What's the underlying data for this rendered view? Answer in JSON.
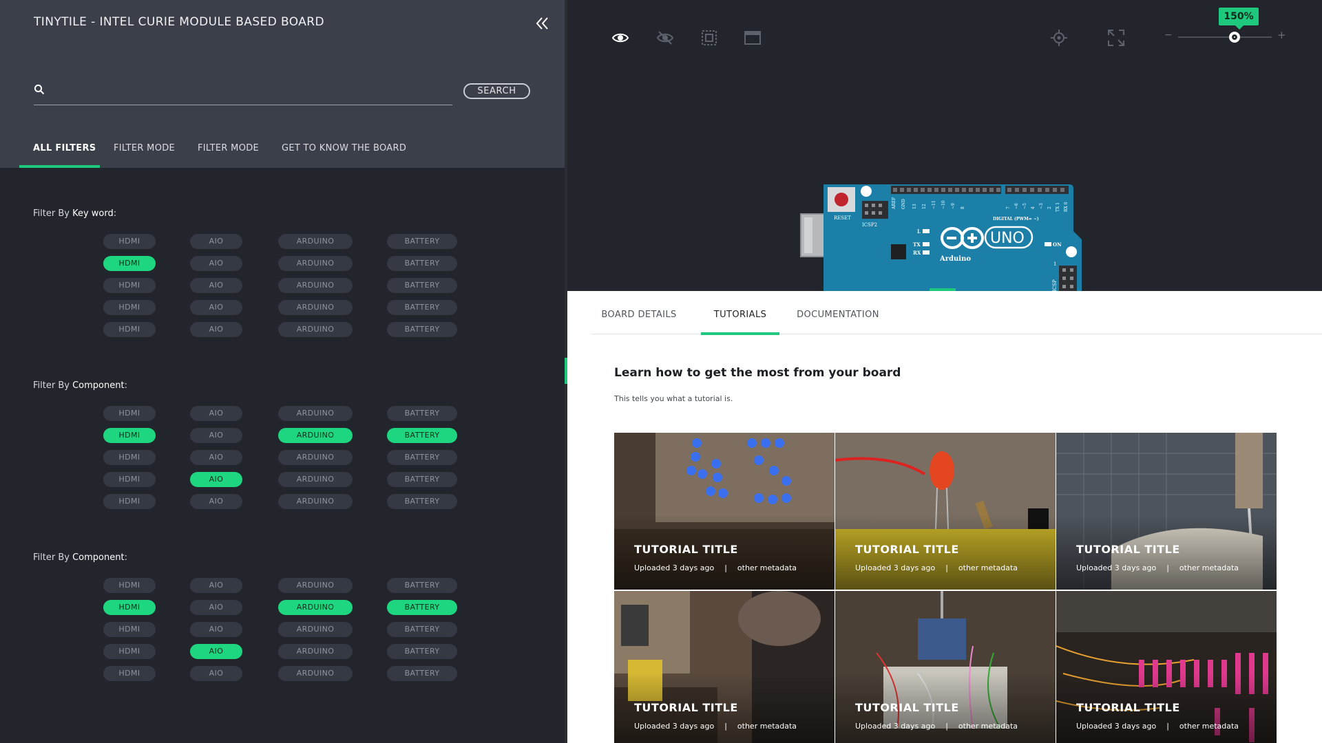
{
  "app": {
    "board_title": "TINYTILE - INTEL CURIE MODULE BASED BOARD"
  },
  "search": {
    "value": "",
    "placeholder": "",
    "button_label": "SEARCH"
  },
  "filter_tabs": [
    {
      "label": "ALL FILTERS",
      "active": true
    },
    {
      "label": "FILTER MODE",
      "active": false
    },
    {
      "label": "FILTER MODE",
      "active": false
    },
    {
      "label": "GET TO KNOW THE BOARD",
      "active": false
    }
  ],
  "filter_sections": [
    {
      "label_prefix": "Filter By ",
      "label_keyword": "Key word",
      "label_suffix": ":",
      "rows": [
        [
          {
            "label": "HDMI",
            "on": false
          },
          {
            "label": "AIO",
            "on": false
          },
          {
            "label": "ARDUINO",
            "on": false
          },
          {
            "label": "BATTERY",
            "on": false
          }
        ],
        [
          {
            "label": "HDMI",
            "on": true
          },
          {
            "label": "AIO",
            "on": false
          },
          {
            "label": "ARDUINO",
            "on": false
          },
          {
            "label": "BATTERY",
            "on": false
          }
        ],
        [
          {
            "label": "HDMI",
            "on": false
          },
          {
            "label": "AIO",
            "on": false
          },
          {
            "label": "ARDUINO",
            "on": false
          },
          {
            "label": "BATTERY",
            "on": false
          }
        ],
        [
          {
            "label": "HDMI",
            "on": false
          },
          {
            "label": "AIO",
            "on": false
          },
          {
            "label": "ARDUINO",
            "on": false
          },
          {
            "label": "BATTERY",
            "on": false
          }
        ],
        [
          {
            "label": "HDMI",
            "on": false
          },
          {
            "label": "AIO",
            "on": false
          },
          {
            "label": "ARDUINO",
            "on": false
          },
          {
            "label": "BATTERY",
            "on": false
          }
        ]
      ]
    },
    {
      "label_prefix": "Filter By ",
      "label_keyword": "Component",
      "label_suffix": ":",
      "rows": [
        [
          {
            "label": "HDMI",
            "on": false
          },
          {
            "label": "AIO",
            "on": false
          },
          {
            "label": "ARDUINO",
            "on": false
          },
          {
            "label": "BATTERY",
            "on": false
          }
        ],
        [
          {
            "label": "HDMI",
            "on": true
          },
          {
            "label": "AIO",
            "on": false
          },
          {
            "label": "ARDUINO",
            "on": true
          },
          {
            "label": "BATTERY",
            "on": true
          }
        ],
        [
          {
            "label": "HDMI",
            "on": false
          },
          {
            "label": "AIO",
            "on": false
          },
          {
            "label": "ARDUINO",
            "on": false
          },
          {
            "label": "BATTERY",
            "on": false
          }
        ],
        [
          {
            "label": "HDMI",
            "on": false
          },
          {
            "label": "AIO",
            "on": true
          },
          {
            "label": "ARDUINO",
            "on": false
          },
          {
            "label": "BATTERY",
            "on": false
          }
        ],
        [
          {
            "label": "HDMI",
            "on": false
          },
          {
            "label": "AIO",
            "on": false
          },
          {
            "label": "ARDUINO",
            "on": false
          },
          {
            "label": "BATTERY",
            "on": false
          }
        ]
      ]
    },
    {
      "label_prefix": "Filter By ",
      "label_keyword": "Component",
      "label_suffix": ":",
      "rows": [
        [
          {
            "label": "HDMI",
            "on": false
          },
          {
            "label": "AIO",
            "on": false
          },
          {
            "label": "ARDUINO",
            "on": false
          },
          {
            "label": "BATTERY",
            "on": false
          }
        ],
        [
          {
            "label": "HDMI",
            "on": true
          },
          {
            "label": "AIO",
            "on": false
          },
          {
            "label": "ARDUINO",
            "on": true
          },
          {
            "label": "BATTERY",
            "on": true
          }
        ],
        [
          {
            "label": "HDMI",
            "on": false
          },
          {
            "label": "AIO",
            "on": false
          },
          {
            "label": "ARDUINO",
            "on": false
          },
          {
            "label": "BATTERY",
            "on": false
          }
        ],
        [
          {
            "label": "HDMI",
            "on": false
          },
          {
            "label": "AIO",
            "on": true
          },
          {
            "label": "ARDUINO",
            "on": false
          },
          {
            "label": "BATTERY",
            "on": false
          }
        ],
        [
          {
            "label": "HDMI",
            "on": false
          },
          {
            "label": "AIO",
            "on": false
          },
          {
            "label": "ARDUINO",
            "on": false
          },
          {
            "label": "BATTERY",
            "on": false
          }
        ]
      ]
    }
  ],
  "toolbar": {
    "icons": [
      "eye-icon",
      "eye-off-icon",
      "select-area-icon",
      "window-icon",
      "crosshair-icon",
      "fullscreen-icon"
    ],
    "zoom_label": "150%",
    "zoom_minus": "−",
    "zoom_plus": "+",
    "zoom_level": 0.6
  },
  "board_image": {
    "labels": [
      "RESET",
      "ICSP2",
      "AREF",
      "GND",
      "13",
      "12",
      "~11",
      "~10",
      "~9",
      "8",
      "7",
      "~6",
      "~5",
      "4",
      "~3",
      "2",
      "TX 1",
      "RX 0",
      "DIGITAL (PWM= ~)",
      "L",
      "TX",
      "RX",
      "ON",
      "UNO",
      "Arduino",
      "ICSP",
      "1"
    ]
  },
  "detail_tabs": [
    {
      "label": "BOARD DETAILS",
      "active": false
    },
    {
      "label": "TUTORIALS",
      "active": true
    },
    {
      "label": "DOCUMENTATION",
      "active": false
    }
  ],
  "tutorials": {
    "heading": "Learn how to get the most from your board",
    "description": "This tells you what a tutorial is.",
    "cards": [
      {
        "title": "TUTORIAL TITLE",
        "uploaded": "Uploaded 3 days ago",
        "separator": "|",
        "meta": "other metadata"
      },
      {
        "title": "TUTORIAL TITLE",
        "uploaded": "Uploaded 3 days ago",
        "separator": "|",
        "meta": "other metadata"
      },
      {
        "title": "TUTORIAL TITLE",
        "uploaded": "Uploaded 3 days ago",
        "separator": "|",
        "meta": "other metadata"
      },
      {
        "title": "TUTORIAL TITLE",
        "uploaded": "Uploaded 3 days ago",
        "separator": "|",
        "meta": "other metadata"
      },
      {
        "title": "TUTORIAL TITLE",
        "uploaded": "Uploaded 3 days ago",
        "separator": "|",
        "meta": "other metadata"
      },
      {
        "title": "TUTORIAL TITLE",
        "uploaded": "Uploaded 3 days ago",
        "separator": "|",
        "meta": "other metadata"
      }
    ]
  },
  "colors": {
    "accent": "#1ec97e",
    "header_bg": "#3b3f4a",
    "panel_bg": "#22252b",
    "chip_off": "#353943",
    "board_blue": "#1b7fa8"
  }
}
